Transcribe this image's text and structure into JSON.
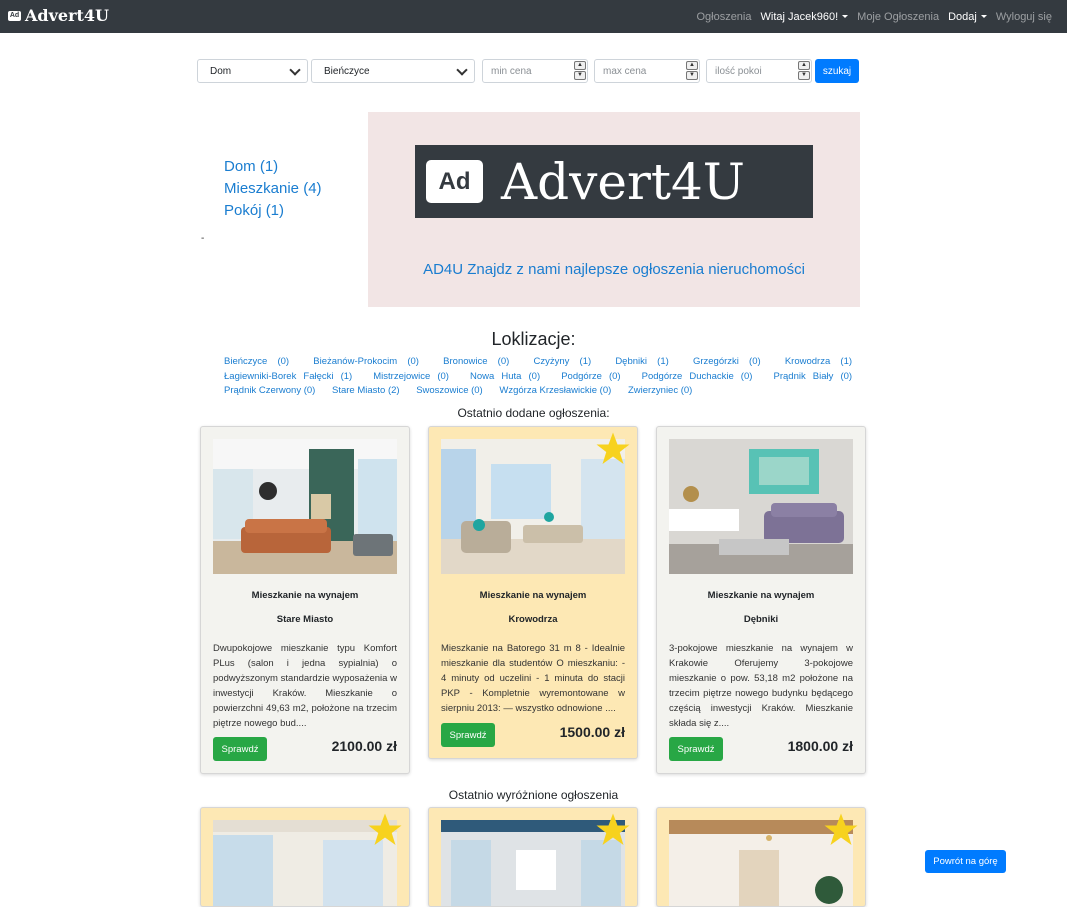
{
  "nav": {
    "brand": "Advert4U",
    "brand_badge": "Ad",
    "links": {
      "ogloszenia": "Ogłoszenia",
      "user": "Witaj Jacek960!",
      "moje": "Moje Ogłoszenia",
      "dodaj": "Dodaj",
      "wyloguj": "Wyloguj się"
    }
  },
  "search": {
    "type_value": "Dom",
    "location_value": "Bieńczyce",
    "min_price_placeholder": "min cena",
    "max_price_placeholder": "max cena",
    "rooms_placeholder": "ilość pokoi",
    "button": "szukaj"
  },
  "categories": [
    "Dom (1)",
    "Mieszkanie (4)",
    "Pokój (1)"
  ],
  "dash": "-",
  "hero": {
    "logo_badge": "Ad",
    "logo_text": "Advert4U",
    "tagline": "AD4U Znajdz z nami najlepsze ogłoszenia nieruchomości"
  },
  "locations_title": "Loklizacje:",
  "locations": [
    "Bieńczyce (0)",
    "Bieżanów-Prokocim (0)",
    "Bronowice (0)",
    "Czyżyny (1)",
    "Dębniki (1)",
    "Grzegórzki (0)",
    "Krowodrza (1)",
    "Łagiewniki-Borek Fałęcki (1)",
    "Mistrzejowice (0)",
    "Nowa Huta (0)",
    "Podgórze (0)",
    "Podgórze Duchackie (0)",
    "Prądnik Biały (0)",
    "Prądnik Czerwony (0)",
    "Stare Miasto (2)",
    "Swoszowice (0)",
    "Wzgórza Krzesławickie (0)",
    "Zwierzyniec (0)"
  ],
  "recent_title": "Ostatnio dodane ogłoszenia:",
  "featured_title": "Ostatnio wyróżnione ogłoszenia",
  "button_check": "Sprawdź",
  "cards": [
    {
      "title": "Mieszkanie na wynajem",
      "location": "Stare Miasto",
      "description": "Dwupokojowe mieszkanie typu Komfort PLus (salon i jedna sypialnia) o podwyższonym standardzie wyposażenia w inwestycji Kraków. Mieszkanie o powierzchni 49,63 m2, położone na trzecim piętrze nowego bud....",
      "price": "2100.00 zł",
      "featured": false
    },
    {
      "title": "Mieszkanie na wynajem",
      "location": "Krowodrza",
      "description": "Mieszkanie na Batorego 31 m 8 - Idealnie mieszkanie dla studentów O mieszkaniu: - 4 minuty od uczelini - 1 minuta do stacji PKP - Kompletnie wyremontowane w sierpniu 2013: — wszystko odnowione ....",
      "price": "1500.00 zł",
      "featured": true
    },
    {
      "title": "Mieszkanie na wynajem",
      "location": "Dębniki",
      "description": "3-pokojowe mieszkanie na wynajem w Krakowie Oferujemy 3-pokojowe mieszkanie o pow. 53,18 m2 położone na trzecim piętrze nowego budynku będącego częścią inwestycji Kraków. Mieszkanie składa się z....",
      "price": "1800.00 zł",
      "featured": false
    }
  ],
  "back_to_top": "Powrót na górę",
  "colors": {
    "navbar": "#343a40",
    "link": "#1a7dd0",
    "primary": "#007bff",
    "success": "#28a745",
    "featured_card": "#fde8b4",
    "card": "#f3f3ef",
    "hero_bg": "#f2e5e5",
    "star": "#f7d21e"
  }
}
